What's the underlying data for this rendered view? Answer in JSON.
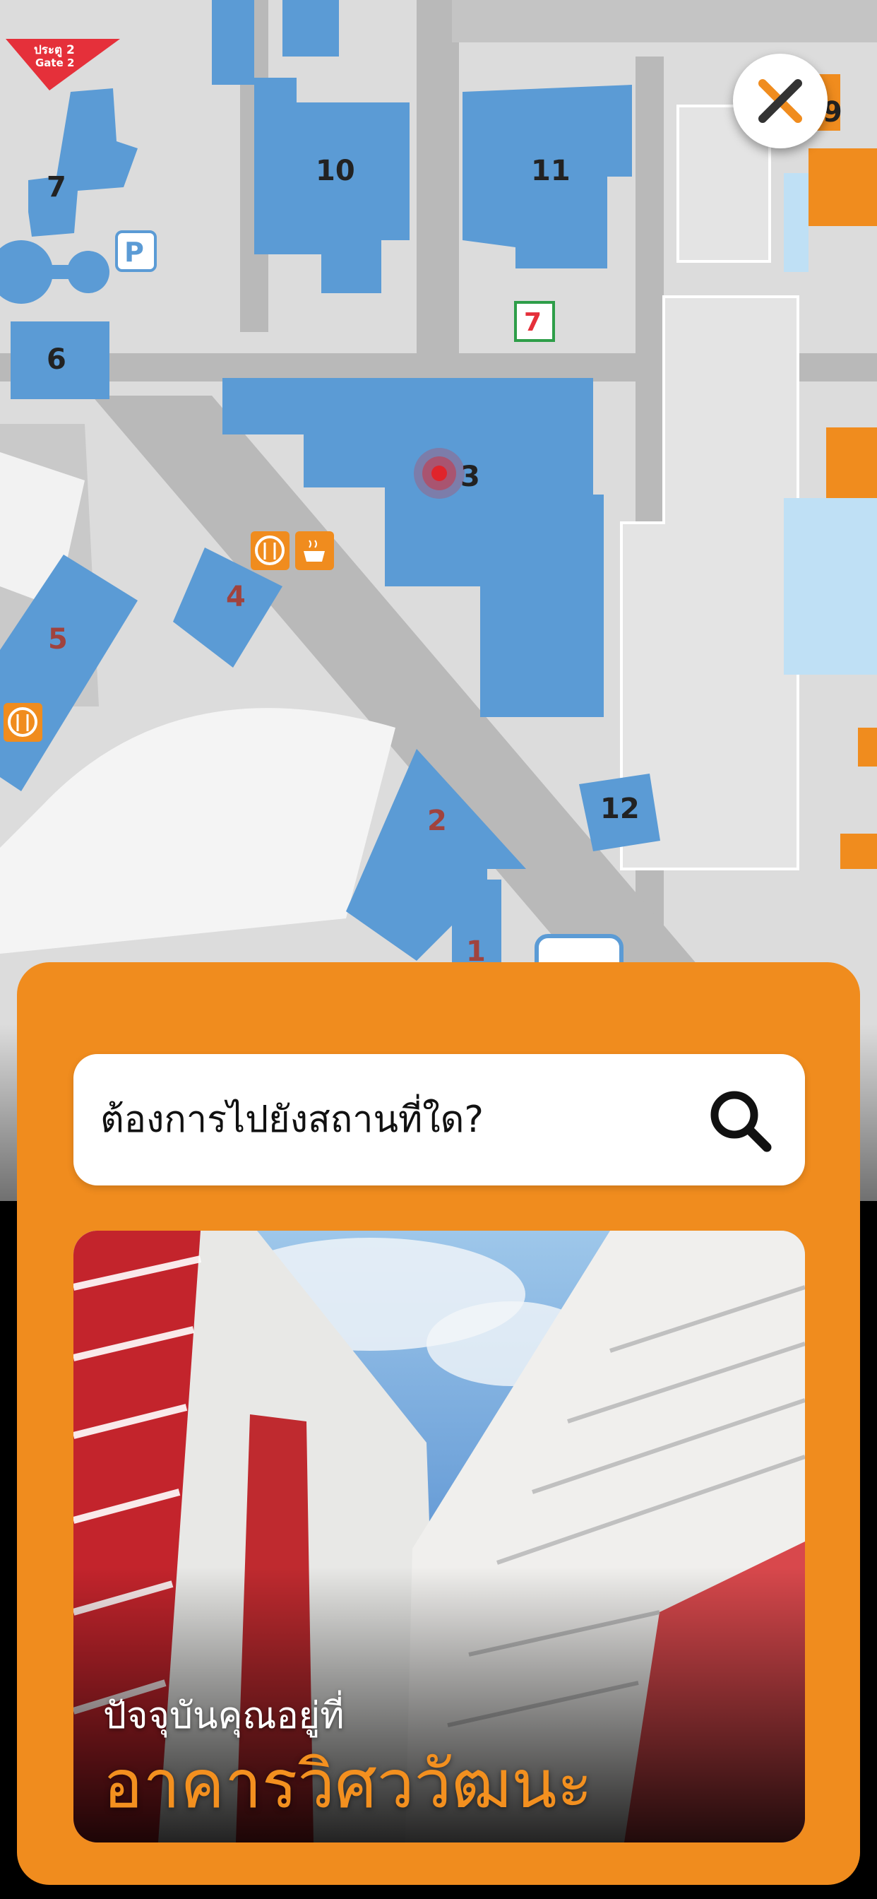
{
  "map": {
    "gate_label_line1": "ประตู 2",
    "gate_label_line2": "Gate 2",
    "buildings": [
      "7",
      "10",
      "11",
      "9",
      "6",
      "3",
      "4",
      "5",
      "2",
      "12",
      "1"
    ],
    "parking_label": "P",
    "store_label": "7"
  },
  "search": {
    "placeholder": "ต้องการไปยังสถานที่ใด?"
  },
  "location": {
    "subtitle": "ปัจจุบันคุณอยู่ที่",
    "name": "อาคารวิศววัฒนะ"
  },
  "colors": {
    "accent": "#f08c1e",
    "building": "#5b9bd5",
    "marker": "#e0242b"
  }
}
